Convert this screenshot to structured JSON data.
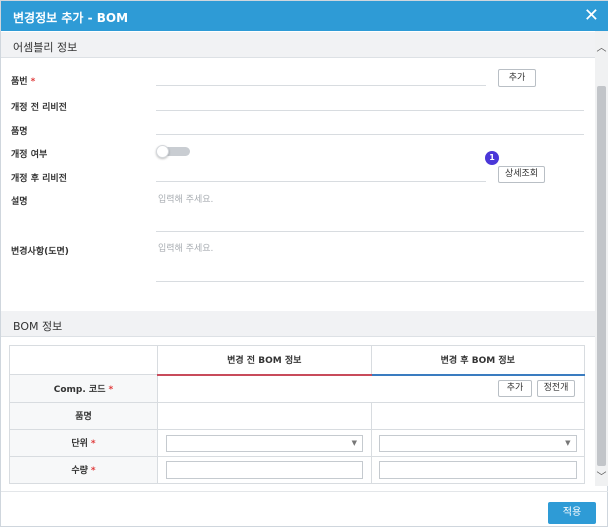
{
  "window": {
    "title": "변경정보 추가 - BOM",
    "close_label": "✕"
  },
  "assembly": {
    "section_title": "어셈블리 정보",
    "part_no_label": "품번",
    "add_button": "추가",
    "rev_before_label": "개정 전 리비전",
    "part_name_label": "품명",
    "revise_label": "개정 여부",
    "revise_on": false,
    "rev_after_label": "개정 후 리비전",
    "badge": "1",
    "detail_button": "상세조회",
    "desc_label": "설명",
    "desc_placeholder": "입력해 주세요.",
    "change_label": "변경사항(도면)",
    "change_placeholder": "입력해 주세요."
  },
  "bom": {
    "section_title": "BOM 정보",
    "col_before": "변경 전 BOM 정보",
    "col_after": "변경 후 BOM 정보",
    "comp_code_label": "Comp. 코드",
    "add_button": "추가",
    "positive_button": "정전개",
    "part_name_label": "품명",
    "unit_label": "단위",
    "qty_label": "수량"
  },
  "footer": {
    "apply_button": "적용"
  },
  "colors": {
    "title_bar": "#2e9bd6",
    "apply": "#2e9bd6",
    "badge": "#4a37d8",
    "before_line": "#c84b5b",
    "after_line": "#3a7cc0"
  }
}
